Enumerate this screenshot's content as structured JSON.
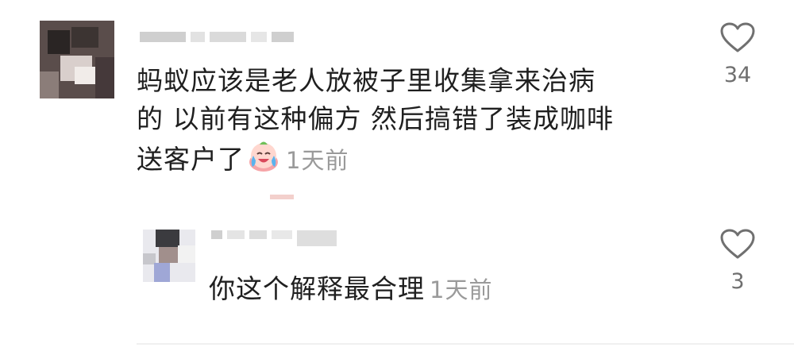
{
  "comment": {
    "avatar": "blurred-avatar",
    "line1": "蚂蚁应该是老人放被子里收集拿来治病",
    "line2": "的 以前有这种偏方 然后搞错了装成咖啡",
    "line3": "送客户了",
    "emoji": "crying-laughing-emoji",
    "time": "1天前",
    "likes": "34"
  },
  "reply": {
    "avatar": "blurred-avatar",
    "text": "你这个解释最合理",
    "time": "1天前",
    "likes": "3"
  },
  "icons": {
    "like": "heart-outline-icon"
  },
  "colors": {
    "text": "#1f1f1f",
    "meta": "#9a9a9a",
    "count": "#6f6f6f",
    "icon": "#707070"
  }
}
